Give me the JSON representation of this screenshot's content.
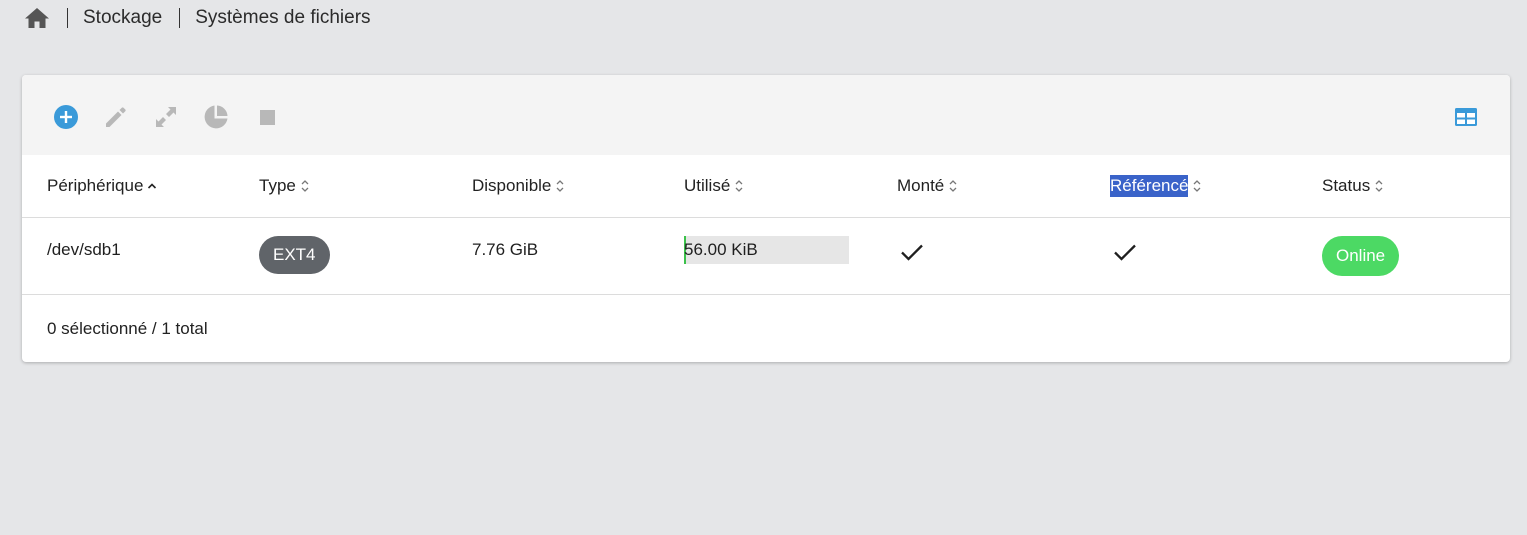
{
  "breadcrumb": {
    "home_icon": "home-icon",
    "items": [
      "Stockage",
      "Systèmes de fichiers"
    ]
  },
  "toolbar": {
    "buttons": [
      {
        "name": "add-button",
        "icon": "plus-circle-icon",
        "color": "#3a9ad9"
      },
      {
        "name": "edit-button",
        "icon": "pencil-icon",
        "color": "#b8b8b8"
      },
      {
        "name": "resize-button",
        "icon": "expand-icon",
        "color": "#b8b8b8"
      },
      {
        "name": "quota-button",
        "icon": "pie-chart-icon",
        "color": "#b8b8b8"
      },
      {
        "name": "unmount-button",
        "icon": "stop-icon",
        "color": "#b8b8b8"
      }
    ],
    "right_icon": "table-columns-icon",
    "accent": "#3a9ad9"
  },
  "table": {
    "columns": [
      {
        "key": "device",
        "label": "Périphérique",
        "sort": "asc"
      },
      {
        "key": "type",
        "label": "Type",
        "sort": "both"
      },
      {
        "key": "available",
        "label": "Disponible",
        "sort": "both"
      },
      {
        "key": "used",
        "label": "Utilisé",
        "sort": "both"
      },
      {
        "key": "mounted",
        "label": "Monté",
        "sort": "both"
      },
      {
        "key": "referenced",
        "label": "Référencé",
        "sort": "both",
        "highlighted": true
      },
      {
        "key": "status",
        "label": "Status",
        "sort": "both"
      }
    ],
    "rows": [
      {
        "device": "/dev/sdb1",
        "type": "EXT4",
        "available": "7.76 GiB",
        "used": "56.00 KiB",
        "used_fraction": 0.007,
        "mounted": true,
        "referenced": true,
        "status": "Online"
      }
    ]
  },
  "colors": {
    "type_badge": "#606469",
    "status_online": "#4cd964",
    "usage_fill": "#3bc14a",
    "selection": "#3a63c9"
  },
  "footer": {
    "summary": "0 sélectionné / 1 total"
  }
}
